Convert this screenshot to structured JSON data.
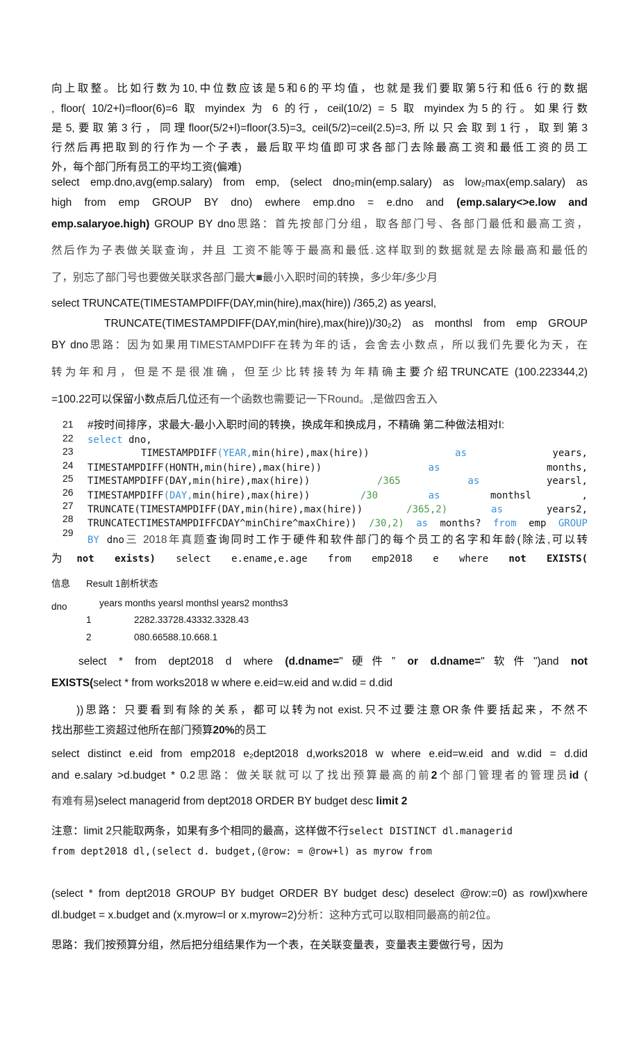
{
  "colors": {
    "keyword": "#3b8fd6",
    "number": "#4a9a4a",
    "text": "#111111"
  },
  "lines": [
    [
      {
        "text": "向上取整。比如行数为10,中位数应该是5和6的平均值，也就是我们要取第5行和低6 行的数据"
      }
    ],
    [
      {
        "text": ", floor( 10/2+l)=floor(6)=6 取 myindex 为 6 的行，ceil(10/2) = 5 取 myindex为5的行。如果行数"
      }
    ],
    [
      {
        "text": "是5,要取第3行，同理floor(5/2+l)=floor(3.5)=3„ ceil(5/2)=ceil(2.5)=3,所以只会取到1行，取到第3"
      }
    ],
    [
      {
        "text": "行然后再把取到的行作为一个子表，最后取平均值即可求各部门去除最高工资和最低工资的员工"
      }
    ],
    [
      {
        "text": "外，每个部门所有员工的平均工资(偏难)"
      }
    ],
    [
      {
        "text": "select emp.dno,avg(emp.salary) from emp, (select dno₂min(emp.salary) as low₂max(emp.salary) as"
      }
    ],
    [
      {
        "text": "high from emp GROUP BY dno) ewhere emp.dno = e.dno and "
      },
      {
        "text": "(emp.salary<>e.low and",
        "style": "b"
      }
    ],
    [
      {
        "text": "emp.salaryoe.high)",
        "style": "b"
      },
      {
        "text": " GROUP BY dno"
      },
      {
        "text": "思路：首先按部门分组，取各部门号、各部门最低和最高工资，",
        "style": "g"
      }
    ],
    [
      {
        "text": "然后作为子表做关联查询，并且 工资不能等于最高和最低.这样取到的数据就是去除最高和最低的",
        "style": "g"
      }
    ],
    [
      {
        "text": "了，别忘了部门号也要做关联求各部门最大■最小入职时间的转换，多少年/多少月",
        "style": "g"
      }
    ],
    [
      {
        "text": "select TRUNCATE(TIMESTAMPDIFF(DAY,min(hire),max(hire)) /365,2) as yearsl,"
      }
    ],
    [
      {
        "text": "TRUNCATE(TIMESTAMPDIFF(DAY,min(hire),max(hire))/30₂2) as monthsl from emp GROUP"
      }
    ],
    [
      {
        "text": "BY dno"
      },
      {
        "text": "思路：因为如果用TIMESTAMPDIFF在转为年的话，会舍去小数点，所以我们先要化为天，在",
        "style": "g"
      }
    ],
    [
      {
        "text": "转为年和月，但是不是很准确，但至少比转接转为年精确",
        "style": "g"
      },
      {
        "text": "主要介绍TRUNCATE"
      },
      {
        "text": " (100.223344,2)"
      }
    ],
    [
      {
        "text": "=100.22可以保留小数点后几位"
      },
      {
        "text": "还有一个函数也需要记一下Round。,是做四舍五入",
        "style": "g"
      }
    ],
    [
      {
        "text": "#按时间排序，求最大-最小入职时间的转换，换成年和换成月，不精确 第二种做法相对I:"
      }
    ],
    [
      {
        "text": "select",
        "style": "kw"
      },
      {
        "text": " dno,"
      }
    ],
    [
      {
        "text": "TIMESTAMPDIFF"
      },
      {
        "text": "(YEAR,",
        "style": "kw"
      },
      {
        "text": "min(hire),max(hire)) "
      },
      {
        "text": "as",
        "style": "kw"
      },
      {
        "text": " years,"
      }
    ],
    [
      {
        "text": "TIMESTAMPDIFF(HONTH,min(hire),max(hire)) "
      },
      {
        "text": "as",
        "style": "kw"
      },
      {
        "text": " months,"
      }
    ],
    [
      {
        "text": "TIMESTAMPDIFF(DAY,min(hire),max(hire)) "
      },
      {
        "text": "/365",
        "style": "num"
      },
      {
        "text": " "
      },
      {
        "text": "as",
        "style": "kw"
      },
      {
        "text": " yearsl,"
      }
    ],
    [
      {
        "text": "TIMESTAMPDIFF"
      },
      {
        "text": "(DAY,",
        "style": "kw"
      },
      {
        "text": "min(hire),max(hire)) "
      },
      {
        "text": "/30",
        "style": "num"
      },
      {
        "text": " "
      },
      {
        "text": "as",
        "style": "kw"
      },
      {
        "text": " monthsl ,"
      }
    ],
    [
      {
        "text": "TRUNCATE(TIMESTAMPDIFF(DAY,min(hire),max(hire)) "
      },
      {
        "text": "/365,2)",
        "style": "num"
      },
      {
        "text": " "
      },
      {
        "text": "as",
        "style": "kw"
      },
      {
        "text": " years2,"
      }
    ],
    [
      {
        "text": "TRUNCATECTIMESTAMPDIFFCDAY^minChire^maxChire)) "
      },
      {
        "text": "/30,2)",
        "style": "num"
      },
      {
        "text": " "
      },
      {
        "text": "as",
        "style": "kw"
      },
      {
        "text": " months? "
      },
      {
        "text": "from",
        "style": "kw"
      },
      {
        "text": " emp "
      },
      {
        "text": "GROUP",
        "style": "kw"
      }
    ],
    [
      {
        "text": "BY",
        "style": "kw mono"
      },
      {
        "text": " dno",
        "style": "mono"
      },
      {
        "text": "三 2018年真题",
        "style": "g"
      },
      {
        "text": "查询同时工作于硬件和软件部门的每个员工的名字和年龄(除法,可以转"
      }
    ],
    [
      {
        "text": "为"
      },
      {
        "text": "not exists)",
        "style": "mono b"
      },
      {
        "text": " select e.ename,e.age from emp2018 e where ",
        "style": "mono"
      },
      {
        "text": "not EXISTS(",
        "style": "mono b"
      }
    ],
    [
      {
        "text": "信息"
      }
    ],
    [
      {
        "text": "Result 1剖析状态"
      }
    ],
    [
      {
        "text": "dno"
      }
    ],
    [
      {
        "text": "years months yearsl monthsl years2 months3"
      }
    ],
    [
      {
        "text": "1"
      }
    ],
    [
      {
        "text": "2282.33728.43332.3328.43"
      }
    ],
    [
      {
        "text": "2"
      }
    ],
    [
      {
        "text": "080.66588.10.668.1"
      }
    ],
    [
      {
        "text": "select * from dept2018 d where "
      },
      {
        "text": "(d.dname=",
        "style": "b"
      },
      {
        "text": "\"硬件”"
      },
      {
        "text": " or d.dname=",
        "style": "b"
      },
      {
        "text": "\"软件\")and "
      },
      {
        "text": "not",
        "style": "b"
      }
    ],
    [
      {
        "text": "EXISTS(",
        "style": "b"
      },
      {
        "text": "select * from works2018 w where e.eid=w.eid and w.did = d.did"
      }
    ],
    [
      {
        "text": "))思路：只要看到有除的关系，都可以转为not exist.只不过要注意OR条件要括起来，不然不"
      }
    ],
    [
      {
        "text": "找出那些工资超过他所在部门预算"
      },
      {
        "text": "20%",
        "style": "b"
      },
      {
        "text": "的员工"
      }
    ],
    [
      {
        "text": "select distinct e.eid from emp2018 e₂dept2018 d,works2018 w where e.eid=w.eid and w.did = d.did"
      }
    ],
    [
      {
        "text": "and e.salary >d.budget * 0.2"
      },
      {
        "text": "思路：做关联就可以了找出预算最高的前",
        "style": "g"
      },
      {
        "text": "2",
        "style": "b"
      },
      {
        "text": "个部门管理者的管理员",
        "style": "g"
      },
      {
        "text": "id",
        "style": "b"
      },
      {
        "text": " ("
      }
    ],
    [
      {
        "text": "有难有易",
        "style": "g"
      },
      {
        "text": ")select managerid from dept2018 ORDER BY budget desc "
      },
      {
        "text": "limit 2",
        "style": "b"
      }
    ],
    [
      {
        "text": "注意：limit 2只能取两条，如果有多个相同的最高，这样做不行"
      },
      {
        "text": "select DISTINCT dl.managerid",
        "style": "mono"
      }
    ],
    [
      {
        "text": "from dept2018 dl,(select d. budget,(@row: = @row+l) as myrow from",
        "style": "mono"
      }
    ],
    [
      {
        "text": "(select * from dept2018 GROUP BY budget ORDER BY budget desc) deselect @row:=0) as rowl)xwhere"
      }
    ],
    [
      {
        "text": "dl.budget = x.budget and (x.myrow=l or x.myrow=2)"
      },
      {
        "text": "分析：这种方式可以取相同最高的前2位。",
        "style": "g"
      }
    ],
    [
      {
        "text": "思路：我们按预算分组，然后把分组结果作为一个表，在关联变量表，变量表主要做行号，因为"
      }
    ]
  ],
  "line_numbers": [
    "21",
    "22",
    "23",
    "24",
    "25",
    "26",
    "27",
    "28",
    "29"
  ]
}
